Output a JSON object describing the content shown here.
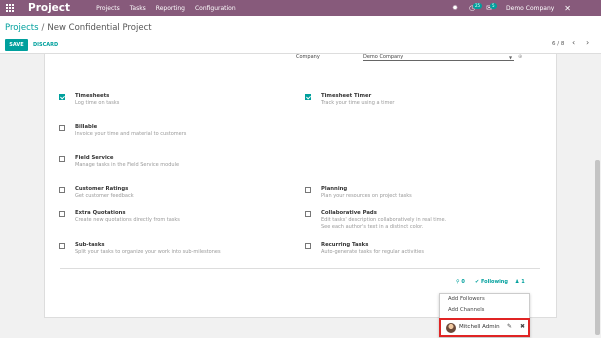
{
  "navbar": {
    "app_name": "Project",
    "menu": [
      "Projects",
      "Tasks",
      "Reporting",
      "Configuration"
    ],
    "activity_badge": "25",
    "messages_badge": "5",
    "company": "Demo Company",
    "brand_color": "#875a7b",
    "accent_color": "#00a09d"
  },
  "breadcrumb": {
    "parent": "Projects",
    "separator": "/",
    "current": "New Confidential Project"
  },
  "actions": {
    "save": "SAVE",
    "discard": "DISCARD"
  },
  "pager": {
    "value": "6 / 8",
    "prev": "‹",
    "next": "›"
  },
  "company_field": {
    "label": "Company",
    "value": "Demo Company"
  },
  "settings": {
    "timesheets": {
      "title": "Timesheets",
      "desc": "Log time on tasks",
      "checked": true
    },
    "timesheet_timer": {
      "title": "Timesheet Timer",
      "desc": "Track your time using a timer",
      "checked": true
    },
    "billable": {
      "title": "Billable",
      "desc": "Invoice your time and material to customers",
      "checked": false
    },
    "field_service": {
      "title": "Field Service",
      "desc": "Manage tasks in the Field Service module",
      "checked": false
    },
    "customer_ratings": {
      "title": "Customer Ratings",
      "desc": "Get customer feedback",
      "checked": false
    },
    "planning": {
      "title": "Planning",
      "desc": "Plan your resources on project tasks",
      "checked": false
    },
    "extra_quotations": {
      "title": "Extra Quotations",
      "desc": "Create new quotations directly from tasks",
      "checked": false
    },
    "collaborative_pads": {
      "title": "Collaborative Pads",
      "desc1": "Edit tasks' description collaboratively in real time.",
      "desc2": "See each author's text in a distinct color.",
      "checked": false
    },
    "sub_tasks": {
      "title": "Sub-tasks",
      "desc": "Split your tasks to organize your work into sub-milestones",
      "checked": false
    },
    "recurring_tasks": {
      "title": "Recurring Tasks",
      "desc": "Auto-generate tasks for regular activities",
      "checked": false
    }
  },
  "chatter": {
    "attachments": "0",
    "following": "Following",
    "followers": "1"
  },
  "followers_dropdown": {
    "add_followers": "Add Followers",
    "add_channels": "Add Channels",
    "follower_name": "Mitchell Admin"
  }
}
